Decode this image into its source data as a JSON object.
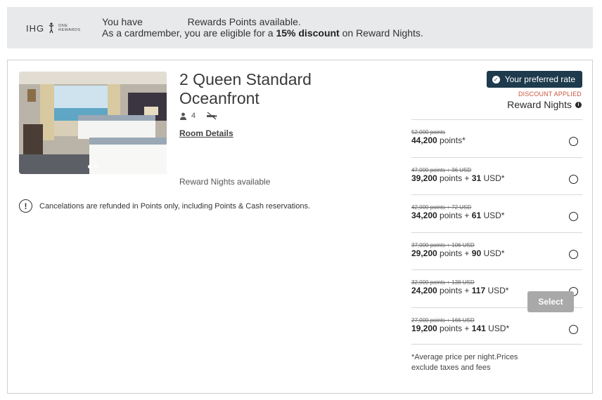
{
  "banner": {
    "logo_text": "IHG",
    "logo_sub_line1": "ONE",
    "logo_sub_line2": "REWARDS",
    "line1_prefix": "You have",
    "line1_suffix": "Rewards Points available.",
    "line2_prefix": "As a cardmember, you are eligible for a",
    "line2_discount": "15% discount",
    "line2_suffix": "on Reward Nights."
  },
  "room": {
    "title": "2 Queen Standard Oceanfront",
    "guests": "4",
    "details_link": "Room Details",
    "availability": "Reward Nights available",
    "cancel_policy": "Cancelations are refunded in Points only, including Points & Cash reservations."
  },
  "rate_panel": {
    "preferred_badge": "Your preferred rate",
    "discount_applied": "DISCOUNT APPLIED",
    "title": "Reward Nights",
    "footnote": "*Average price per night.Prices exclude taxes and fees",
    "select_label": "Select"
  },
  "rates": [
    {
      "old": "52,000 points",
      "points": "44,200",
      "points_label": "points*",
      "cash": "",
      "cash_label": ""
    },
    {
      "old": "47,000 points + 36 USD",
      "points": "39,200",
      "points_label": "points +",
      "cash": "31",
      "cash_label": "USD*"
    },
    {
      "old": "42,000 points + 72 USD",
      "points": "34,200",
      "points_label": "points +",
      "cash": "61",
      "cash_label": "USD*"
    },
    {
      "old": "37,000 points + 106 USD",
      "points": "29,200",
      "points_label": "points +",
      "cash": "90",
      "cash_label": "USD*"
    },
    {
      "old": "32,000 points + 138 USD",
      "points": "24,200",
      "points_label": "points +",
      "cash": "117",
      "cash_label": "USD*"
    },
    {
      "old": "27,000 points + 166 USD",
      "points": "19,200",
      "points_label": "points +",
      "cash": "141",
      "cash_label": "USD*"
    }
  ],
  "colors": {
    "banner_bg": "#e8e9ea",
    "badge_bg": "#1e3a4d",
    "discount_text": "#c8553d",
    "select_disabled": "#a9a9a9"
  }
}
